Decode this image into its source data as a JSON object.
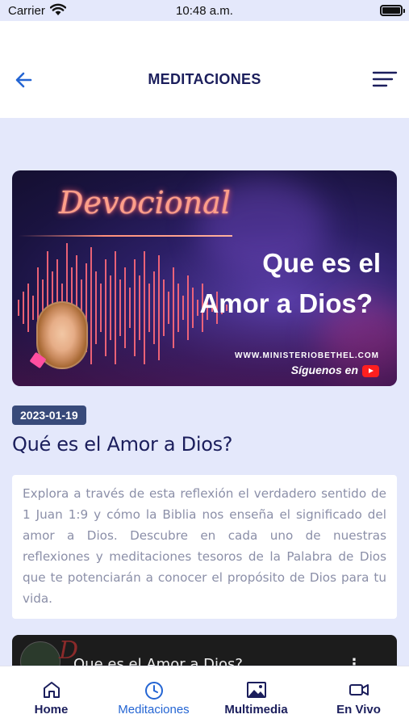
{
  "status_bar": {
    "carrier": "Carrier",
    "time": "10:48 a.m."
  },
  "header": {
    "title": "MEDITACIONES",
    "back_icon": "arrow-left-icon",
    "menu_icon": "menu-lines-icon",
    "accent_color": "#2465d3"
  },
  "banner": {
    "script_text": "Devocional",
    "title_line1": "Que es el",
    "title_line2": "Amor a Dios?",
    "url": "WWW.MINISTERIOBETHEL.COM",
    "follow_text": "Síguenos en"
  },
  "article": {
    "date": "2023-01-19",
    "title": "Qué es el Amor a Dios?",
    "description": "Explora a través de esta reflexión el verdadero sentido de 1 Juan 1:9 y cómo la Biblia nos enseña el significado del amor a Dios. Descubre en cada uno de nuestras reflexiones y meditaciones tesoros de la Palabra de Dios que te potenciarán a conocer el propósito de Dios para tu vida."
  },
  "video": {
    "title": "Que es el Amor a Dios?"
  },
  "tabs": [
    {
      "label": "Home",
      "icon": "home-icon",
      "active": false
    },
    {
      "label": "Meditaciones",
      "icon": "clock-icon",
      "active": true
    },
    {
      "label": "Multimedia",
      "icon": "image-icon",
      "active": false
    },
    {
      "label": "En Vivo",
      "icon": "video-camera-icon",
      "active": false
    }
  ]
}
